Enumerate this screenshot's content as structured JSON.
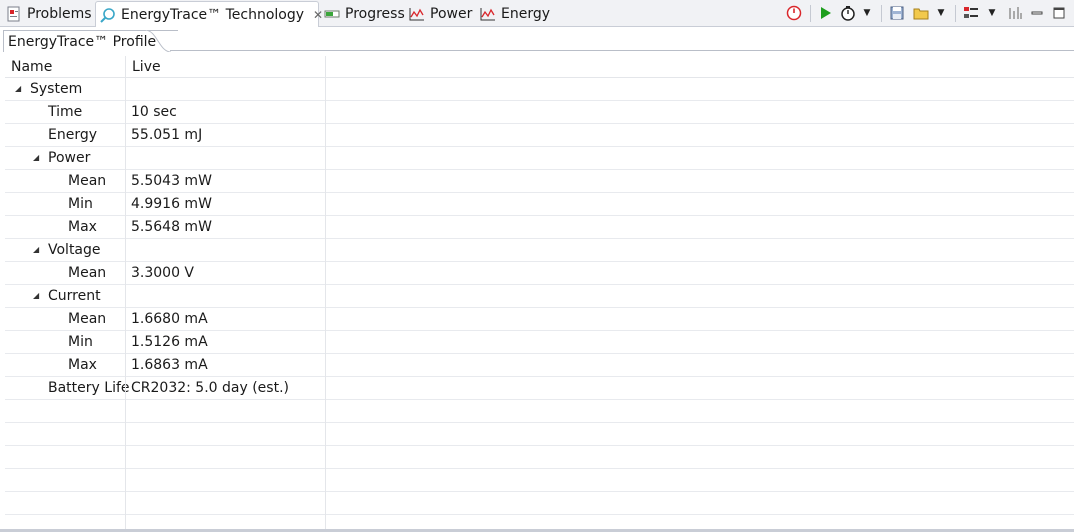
{
  "tabs": [
    {
      "label": "Problems",
      "icon": "problems-icon"
    },
    {
      "label": "EnergyTrace™ Technology",
      "icon": "energytrace-icon",
      "active": true
    },
    {
      "label": "Progress",
      "icon": "progress-icon"
    },
    {
      "label": "Power",
      "icon": "power-graph-icon"
    },
    {
      "label": "Energy",
      "icon": "energy-graph-icon"
    }
  ],
  "toolbar": {
    "icons": [
      "stop-icon",
      "play-icon",
      "timer-icon",
      "save-icon",
      "open-folder-icon",
      "view-menu-icon",
      "chart-toggle-icon",
      "minimize-icon",
      "maximize-icon"
    ]
  },
  "subtab": {
    "label": "EnergyTrace™ Profile"
  },
  "table": {
    "headers": [
      "Name",
      "Live"
    ],
    "rows": [
      {
        "name": "System",
        "value": "",
        "level": 0,
        "expandable": true
      },
      {
        "name": "Time",
        "value": "10 sec",
        "level": 1
      },
      {
        "name": "Energy",
        "value": "55.051 mJ",
        "level": 1
      },
      {
        "name": "Power",
        "value": "",
        "level": 1,
        "expandable": true
      },
      {
        "name": "Mean",
        "value": "5.5043 mW",
        "level": 2
      },
      {
        "name": "Min",
        "value": "4.9916 mW",
        "level": 2
      },
      {
        "name": "Max",
        "value": "5.5648 mW",
        "level": 2
      },
      {
        "name": "Voltage",
        "value": "",
        "level": 1,
        "expandable": true
      },
      {
        "name": "Mean",
        "value": "3.3000 V",
        "level": 2
      },
      {
        "name": "Current",
        "value": "",
        "level": 1,
        "expandable": true
      },
      {
        "name": "Mean",
        "value": "1.6680 mA",
        "level": 2
      },
      {
        "name": "Min",
        "value": "1.5126 mA",
        "level": 2
      },
      {
        "name": "Max",
        "value": "1.6863 mA",
        "level": 2
      },
      {
        "name": "Battery Life",
        "value": "CR2032: 5.0 day (est.)",
        "level": 1
      }
    ]
  },
  "colors": {
    "accent_red": "#d9262b",
    "accent_green": "#1e9e1e",
    "border": "#c9cdd6"
  }
}
